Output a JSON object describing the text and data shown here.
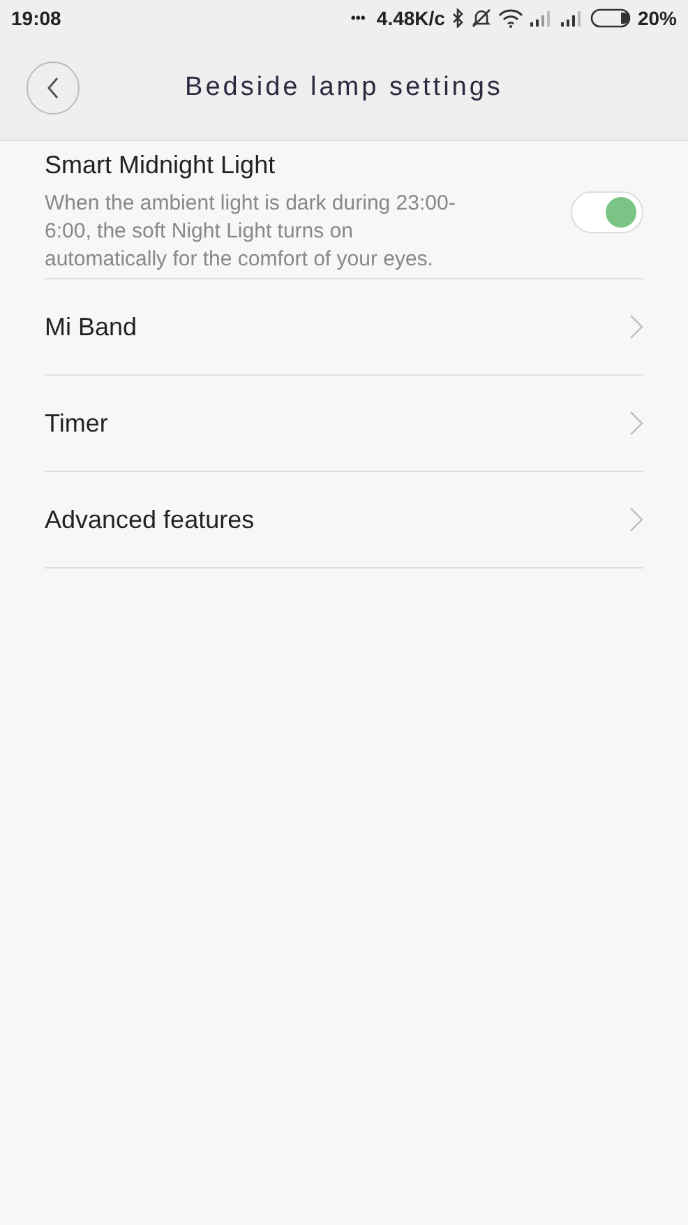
{
  "status_bar": {
    "time": "19:08",
    "dots": "•••",
    "speed": "4.48K/c",
    "battery": "20%"
  },
  "header": {
    "title": "Bedside lamp settings"
  },
  "toggle_item": {
    "title": "Smart Midnight Light",
    "description": "When the ambient light is dark during 23:00-6:00, the soft Night Light turns on automatically for the comfort of your eyes.",
    "on": true
  },
  "items": [
    {
      "label": "Mi Band"
    },
    {
      "label": "Timer"
    },
    {
      "label": "Advanced features"
    }
  ]
}
